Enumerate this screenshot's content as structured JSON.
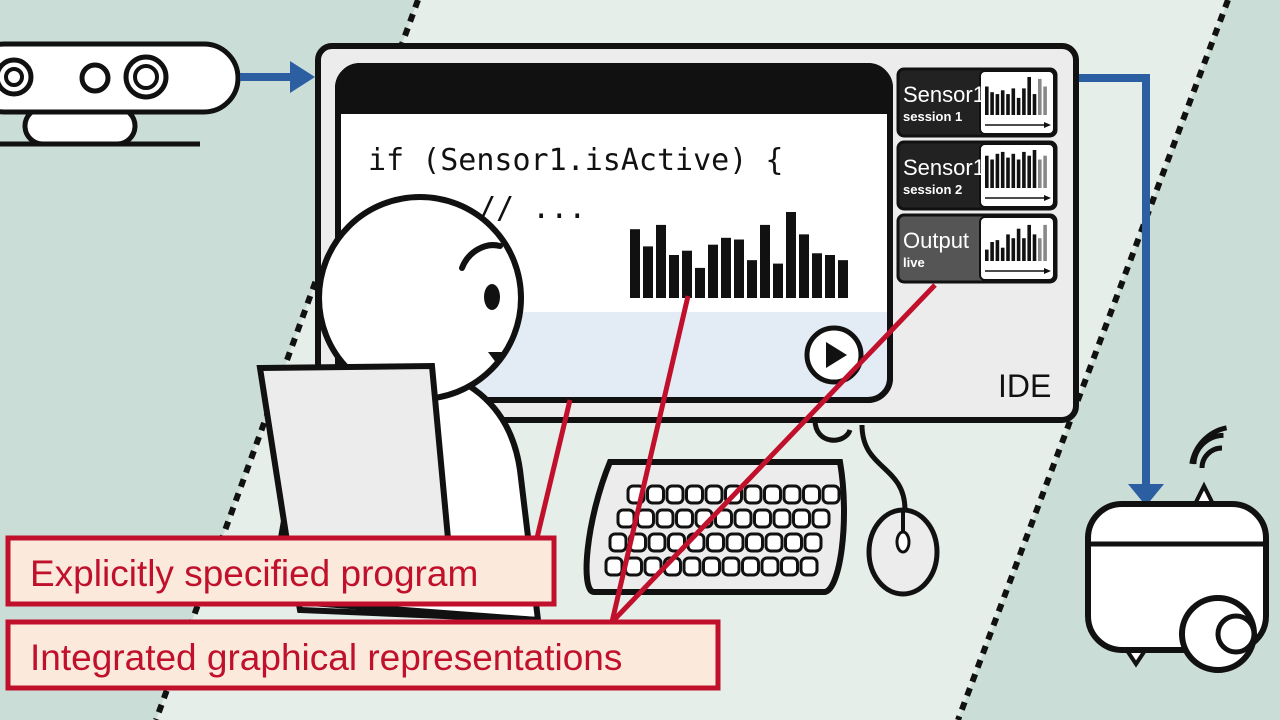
{
  "code": {
    "line1": "if (Sensor1.isActive) {",
    "line2": "// ..."
  },
  "main_waveform": [
    0.8,
    0.6,
    0.85,
    0.5,
    0.55,
    0.35,
    0.62,
    0.7,
    0.68,
    0.44,
    0.85,
    0.4,
    1.0,
    0.74,
    0.52,
    0.5,
    0.44
  ],
  "thumbnails": [
    {
      "title": "Sensor1",
      "subtitle": "session 1",
      "active": false,
      "bars": [
        0.75,
        0.6,
        0.55,
        0.65,
        0.55,
        0.7,
        0.45,
        0.7,
        1.0,
        0.55,
        0.95,
        0.75
      ]
    },
    {
      "title": "Sensor1",
      "subtitle": "session 2",
      "active": false,
      "bars": [
        0.85,
        0.75,
        0.9,
        0.95,
        0.8,
        0.9,
        0.75,
        0.95,
        0.85,
        1.0,
        0.75,
        0.85
      ]
    },
    {
      "title": "Output",
      "subtitle": "live",
      "active": true,
      "bars": [
        0.3,
        0.5,
        0.55,
        0.35,
        0.7,
        0.6,
        0.85,
        0.6,
        0.95,
        0.7,
        0.6,
        0.95
      ]
    }
  ],
  "ide_label": "IDE",
  "callouts": [
    {
      "text": "Explicitly specified program"
    },
    {
      "text": "Integrated graphical representations"
    }
  ],
  "icons": {
    "camera": "depth-camera-icon",
    "robot": "robot-icon",
    "play": "play-icon",
    "wifi": "wifi-icon",
    "keyboard": "keyboard-icon",
    "mouse": "mouse-icon"
  },
  "colors": {
    "background_outer": "#cbddd7",
    "background_inner": "#e6eee9",
    "arrow": "#2b5fa2",
    "callout_stroke": "#c0102c",
    "callout_fill": "#fbe9dc",
    "thumb_dark": "#222222",
    "thumb_active": "#555555",
    "output_pane": "#e3ecf5"
  }
}
